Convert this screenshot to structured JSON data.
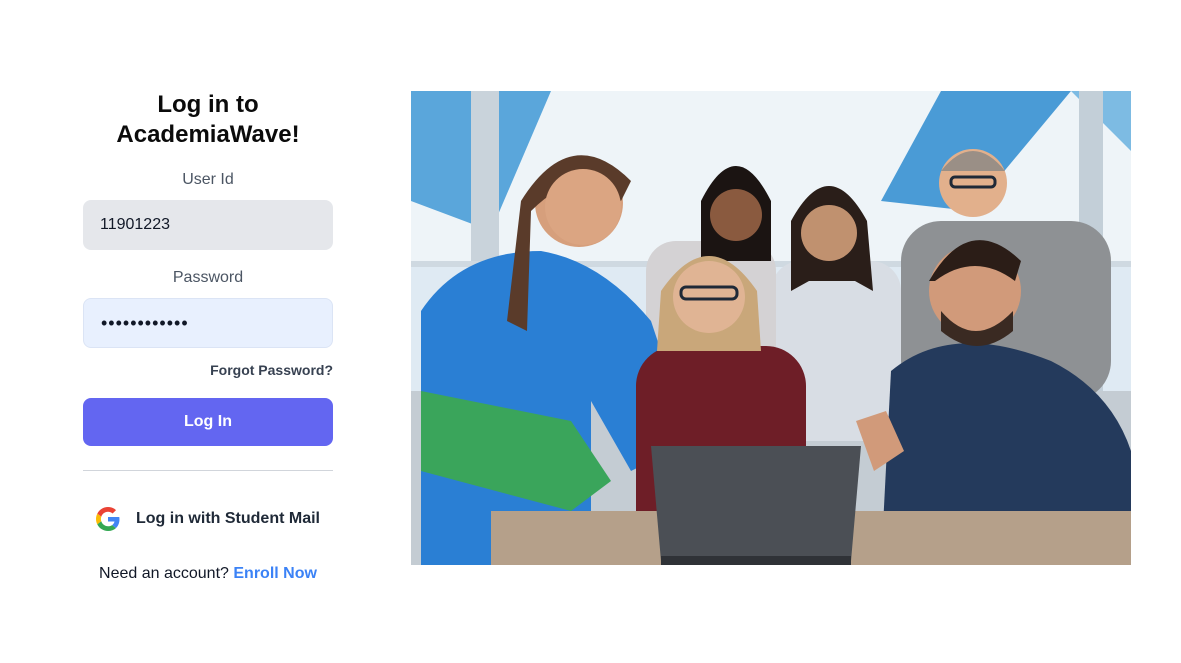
{
  "login": {
    "title_line1": "Log in to",
    "title_line2": "AcademiaWave!",
    "user_id_label": "User Id",
    "user_id_value": "11901223",
    "password_label": "Password",
    "password_value": "••••••••••••",
    "forgot_password": "Forgot Password?",
    "login_button": "Log In",
    "google_button": "Log in with Student Mail",
    "signup_prompt": "Need an account?",
    "enroll_link": "Enroll Now"
  },
  "colors": {
    "primary_button": "#6366f1",
    "link": "#3b82f6",
    "user_input_bg": "#e5e7eb",
    "password_input_bg": "#e8f0fe"
  },
  "icons": {
    "google": "google-g-icon"
  }
}
